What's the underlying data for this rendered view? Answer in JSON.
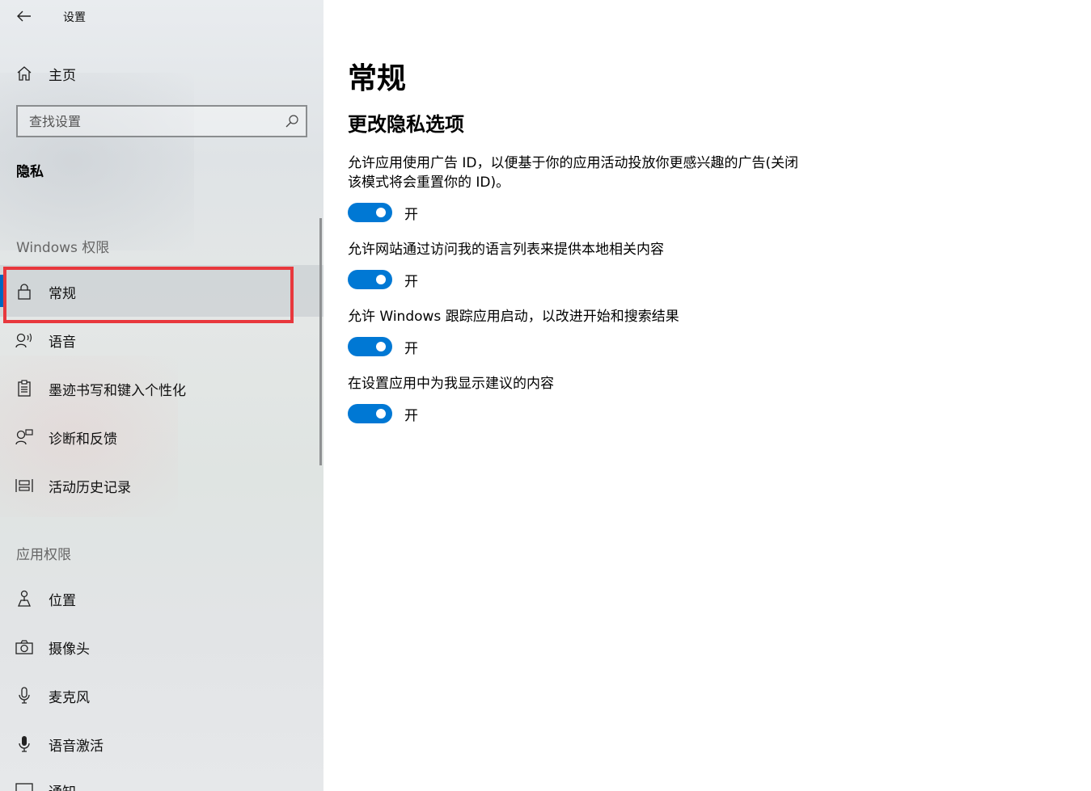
{
  "app": {
    "title": "设置"
  },
  "sidebar": {
    "home_label": "主页",
    "search_placeholder": "查找设置",
    "section_title": "隐私",
    "windows_group": "Windows 权限",
    "windows_items": [
      {
        "label": "常规",
        "icon": "lock-icon",
        "selected": true
      },
      {
        "label": "语音",
        "icon": "speech-icon"
      },
      {
        "label": "墨迹书写和键入个性化",
        "icon": "clipboard-icon"
      },
      {
        "label": "诊断和反馈",
        "icon": "feedback-icon"
      },
      {
        "label": "活动历史记录",
        "icon": "timeline-icon"
      }
    ],
    "app_group": "应用权限",
    "app_items": [
      {
        "label": "位置",
        "icon": "location-icon"
      },
      {
        "label": "摄像头",
        "icon": "camera-icon"
      },
      {
        "label": "麦克风",
        "icon": "microphone-icon"
      },
      {
        "label": "语音激活",
        "icon": "voice-activation-icon"
      },
      {
        "label": "通知",
        "icon": "notification-icon"
      }
    ],
    "accent_color": "#0067c0",
    "highlight_color": "#e8383d"
  },
  "main": {
    "title": "常规",
    "subtitle": "更改隐私选项",
    "settings": [
      {
        "desc": "允许应用使用广告 ID，以便基于你的应用活动投放你更感兴趣的广告(关闭该模式将会重置你的 ID)。",
        "state": "开",
        "on": true
      },
      {
        "desc": "允许网站通过访问我的语言列表来提供本地相关内容",
        "state": "开",
        "on": true
      },
      {
        "desc": "允许 Windows 跟踪应用启动，以改进开始和搜索结果",
        "state": "开",
        "on": true
      },
      {
        "desc": "在设置应用中为我显示建议的内容",
        "state": "开",
        "on": true
      }
    ],
    "toggle_color": "#0078d4"
  }
}
